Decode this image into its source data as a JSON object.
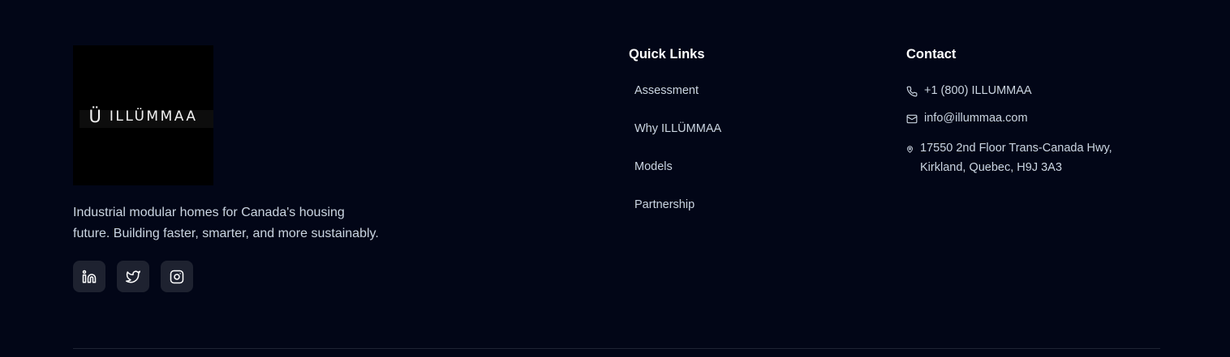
{
  "brand": {
    "logo_mark": "Ü",
    "logo_text": "ILLÜMMAA",
    "tagline": "Industrial modular homes for Canada's housing future. Building faster, smarter, and more sustainably."
  },
  "socials": [
    {
      "name": "linkedin",
      "icon": "linkedin-icon"
    },
    {
      "name": "twitter",
      "icon": "twitter-icon"
    },
    {
      "name": "instagram",
      "icon": "instagram-icon"
    }
  ],
  "quick_links": {
    "title": "Quick Links",
    "items": [
      "Assessment",
      "Why ILLÜMMAA",
      "Models",
      "Partnership"
    ]
  },
  "contact": {
    "title": "Contact",
    "phone": "+1 (800) ILLUMMAA",
    "email": "info@illummaa.com",
    "address_line1": "17550 2nd Floor Trans-Canada Hwy,",
    "address_line2": "Kirkland, Quebec, H9J 3A3"
  },
  "colors": {
    "background": "#020617",
    "text": "#cbd5e1",
    "heading": "#ffffff",
    "social_bg": "#1e2230"
  }
}
